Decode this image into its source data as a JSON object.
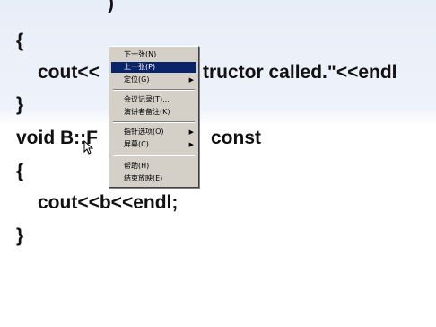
{
  "code": {
    "line0": ")",
    "line1": "{",
    "line2_left": "cout<<",
    "line2_right": "tructor called.\"<<endl",
    "line3": "}",
    "line4_left": "void B::F",
    "line4_right": "const",
    "line5": "{",
    "line6": "cout<<b<<endl;",
    "line7": "}"
  },
  "menu": {
    "items": [
      {
        "label": "下一张(N)",
        "submenu": false
      },
      {
        "label": "上一张(P)",
        "submenu": false,
        "selected": true
      },
      {
        "label": "定位(G)",
        "submenu": true
      },
      {
        "label": "会议记录(T)...",
        "submenu": false
      },
      {
        "label": "演讲者备注(K)",
        "submenu": false
      },
      {
        "label": "指针选项(O)",
        "submenu": true
      },
      {
        "label": "屏幕(C)",
        "submenu": true
      },
      {
        "label": "帮助(H)",
        "submenu": false
      },
      {
        "label": "结束放映(E)",
        "submenu": false
      }
    ],
    "submenu_arrow": "▶",
    "highlight_color": "#0a246a"
  }
}
